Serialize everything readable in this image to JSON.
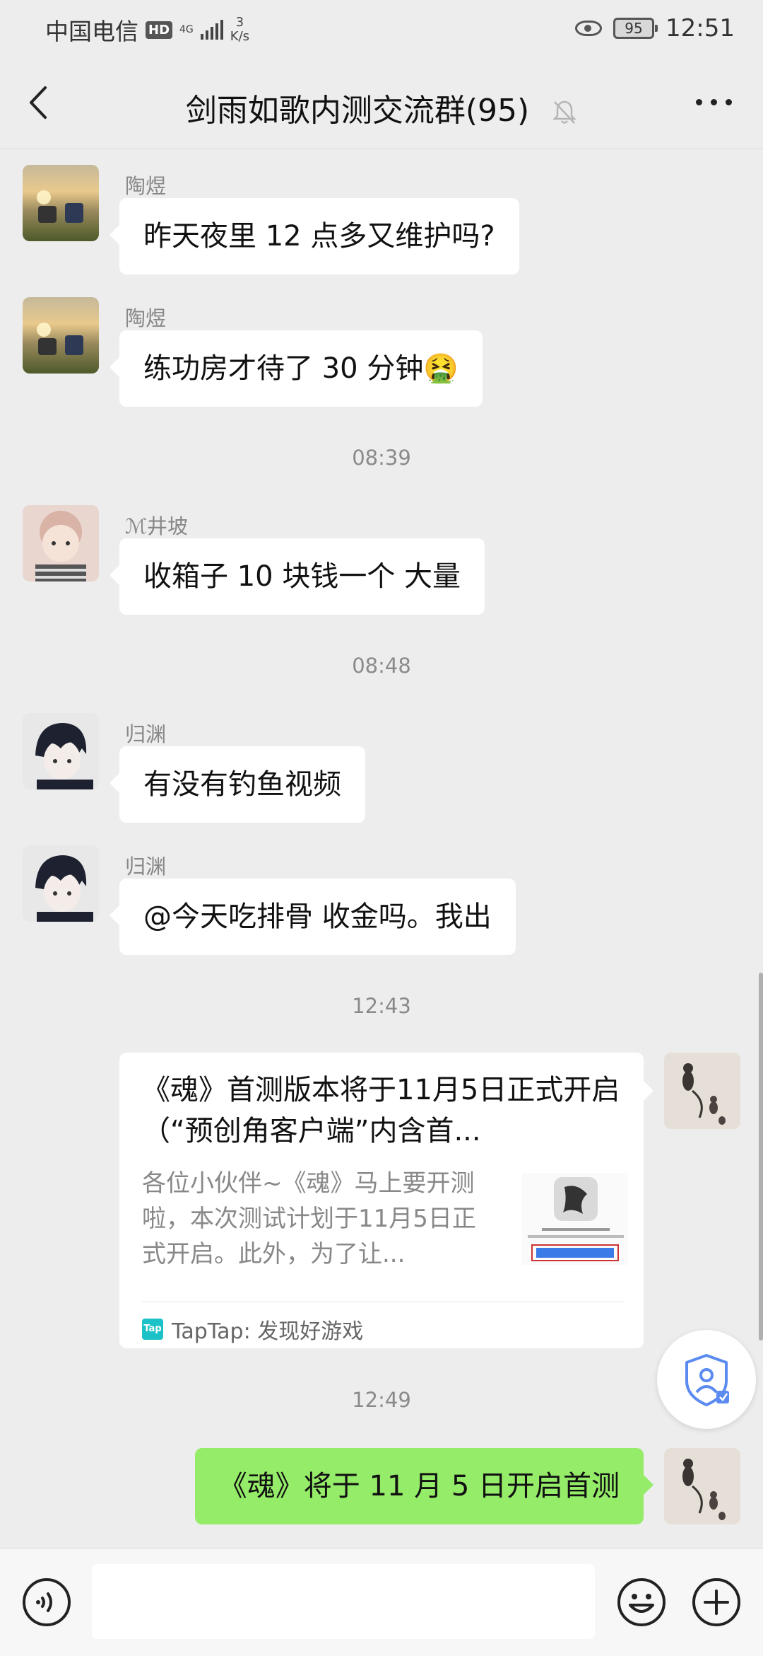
{
  "status_bar": {
    "carrier": "中国电信",
    "hd_badge": "HD",
    "signal_type": "4G",
    "speed_value": "3",
    "speed_unit": "K/s",
    "battery": "95",
    "time": "12:51"
  },
  "header": {
    "title": "剑雨如歌内测交流群(95)",
    "icons": [
      "back-arrow-icon",
      "mute-bell-icon",
      "more-dots-icon"
    ]
  },
  "messages": [
    {
      "sender": "陶煜",
      "text": "昨天夜里 12 点多又维护吗?"
    },
    {
      "sender": "陶煜",
      "text": "练功房才待了 30 分钟🤮"
    },
    {
      "time": "08:39"
    },
    {
      "sender": "ℳ井坡",
      "text": "收箱子 10 块钱一个 大量"
    },
    {
      "time": "08:48"
    },
    {
      "sender": "归渊",
      "text": "有没有钓鱼视频"
    },
    {
      "sender": "归渊",
      "text": "@今天吃排骨  收金吗。我出"
    },
    {
      "time": "12:43"
    },
    {
      "card": {
        "title": "《魂》首测版本将于11月5日正式开启（“预创角客户端”内含首...",
        "description": "各位小伙伴~《魂》马上要开测啦，本次测试计划于11月5日正式开启。此外，为了让...",
        "source_logo": "Tap",
        "source": "TapTap: 发现好游戏"
      }
    },
    {
      "time": "12:49"
    },
    {
      "self": true,
      "text": "《魂》将于 11 月 5 日开启首测"
    }
  ],
  "input_bar": {
    "icons": [
      "voice-icon",
      "emoji-icon",
      "plus-icon"
    ],
    "value": ""
  },
  "colors": {
    "background": "#ededed",
    "self_bubble": "#95ec69",
    "other_bubble": "#ffffff",
    "taptap": "#1dc1c8"
  }
}
